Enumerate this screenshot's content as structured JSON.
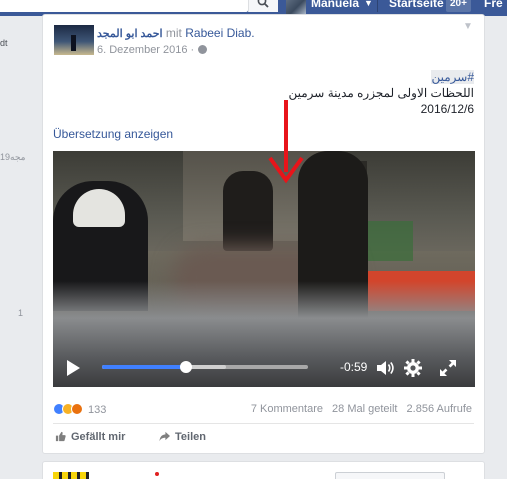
{
  "topbar": {
    "user_name": "Manuela",
    "startseite": "Startseite",
    "badge": "20+",
    "freunde": "Fre"
  },
  "left": {
    "t1": "dt",
    "t2": "19مجه",
    "t3": "1"
  },
  "post": {
    "author": "احمد ابو المجد",
    "mit": "mit",
    "coauthor": "Rabeei Diab.",
    "date": "6. Dezember 2016 ·",
    "hashtag": "#سرمين",
    "line1": "اللحظات الاولى لمجزره مدينة سرمين",
    "line2": "2016/12/6",
    "translate": "Übersetzung anzeigen"
  },
  "video": {
    "time": "-0:59",
    "progress_played": 0.41,
    "progress_buffered": 0.6
  },
  "footer": {
    "reaction_count": "133",
    "comments": "7 Kommentare",
    "shares": "28 Mal geteilt",
    "views": "2.856 Aufrufe",
    "like_label": "Gefällt mir",
    "share_label": "Teilen"
  },
  "colors": {
    "brand": "#3b5998",
    "link": "#365899",
    "annotation_arrow": "#e8141a"
  }
}
